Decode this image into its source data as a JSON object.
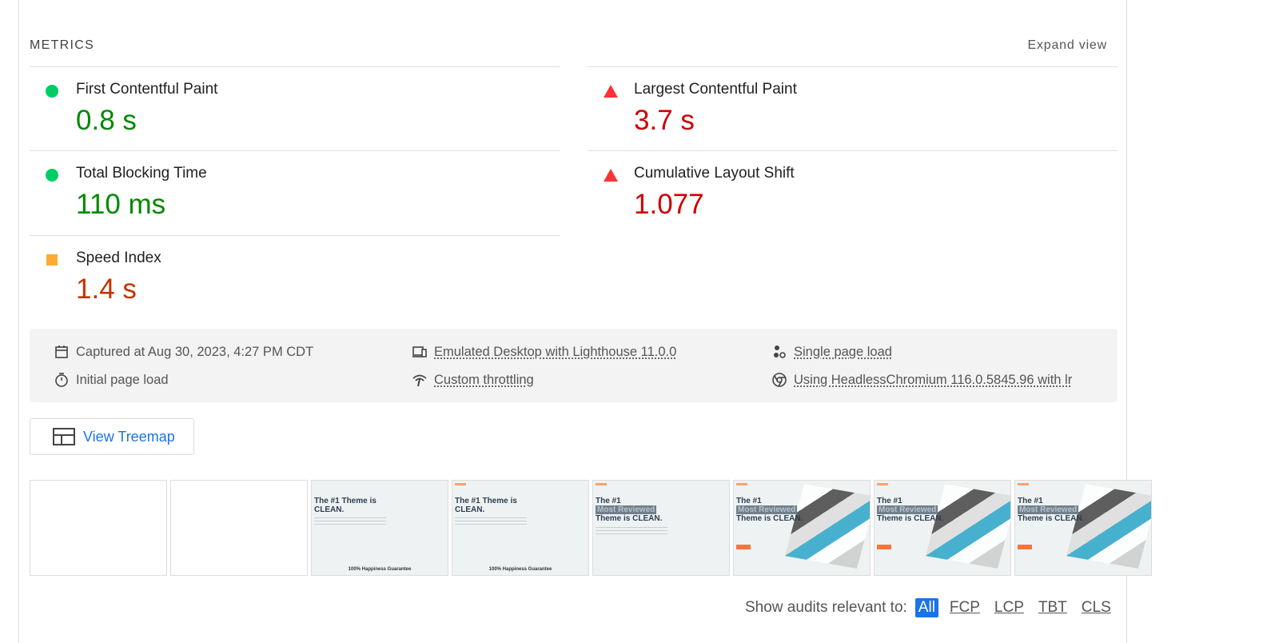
{
  "header": {
    "title": "METRICS",
    "expand": "Expand view"
  },
  "metrics": [
    {
      "name": "First Contentful Paint",
      "value": "0.8 s",
      "rating": "pass",
      "icon": "green-circle-icon"
    },
    {
      "name": "Largest Contentful Paint",
      "value": "3.7 s",
      "rating": "fail",
      "icon": "red-triangle-icon"
    },
    {
      "name": "Total Blocking Time",
      "value": "110 ms",
      "rating": "pass",
      "icon": "green-circle-icon"
    },
    {
      "name": "Cumulative Layout Shift",
      "value": "1.077",
      "rating": "fail",
      "icon": "red-triangle-icon"
    },
    {
      "name": "Speed Index",
      "value": "1.4 s",
      "rating": "average",
      "icon": "orange-square-icon"
    }
  ],
  "colors": {
    "pass": "#008800",
    "fail": "#cc0000",
    "average": "#c33300",
    "accent": "#1a73e8"
  },
  "info": {
    "captured": "Captured at Aug 30, 2023, 4:27 PM CDT",
    "initial": "Initial page load",
    "emulated": "Emulated Desktop with Lighthouse 11.0.0",
    "throttling": "Custom throttling",
    "single": "Single page load",
    "browser": "Using HeadlessChromium 116.0.5845.96 with lr"
  },
  "treemap": "View Treemap",
  "filmstrip": {
    "heading1": "The #1 Theme is CLEAN.",
    "heading_a": "The #1",
    "highlight": "Most Reviewed",
    "heading_b": "Theme is CLEAN.",
    "guarantee": "100% Happiness Guarantee"
  },
  "audits": {
    "label": "Show audits relevant to:",
    "filters": [
      "All",
      "FCP",
      "LCP",
      "TBT",
      "CLS"
    ],
    "selected": "All"
  }
}
